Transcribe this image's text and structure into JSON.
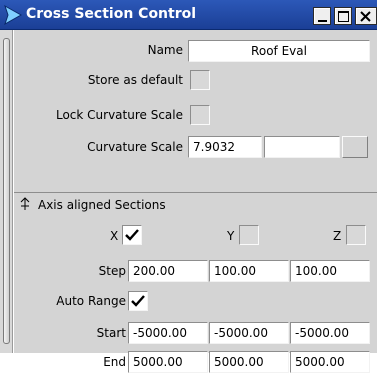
{
  "window": {
    "title": "Cross Section Control",
    "buttons": {
      "minimize_icon": "minimize-icon",
      "maximize_icon": "maximize-icon",
      "close_icon": "close-icon"
    }
  },
  "form": {
    "name_label": "Name",
    "name_value": "Roof Eval",
    "store_default_label": "Store as default",
    "store_default_checked": false,
    "lock_curvature_label": "Lock Curvature Scale",
    "lock_curvature_checked": false,
    "curvature_scale_label": "Curvature Scale",
    "curvature_scale_value": "7.9032"
  },
  "section": {
    "title": "Axis aligned Sections",
    "axes": [
      {
        "label": "X",
        "checked": true
      },
      {
        "label": "Y",
        "checked": false
      },
      {
        "label": "Z",
        "checked": false
      }
    ],
    "step_label": "Step",
    "step_values": [
      "200.00",
      "100.00",
      "100.00"
    ],
    "auto_range_label": "Auto Range",
    "auto_range_checked": true,
    "start_label": "Start",
    "start_values": [
      "-5000.00",
      "-5000.00",
      "-5000.00"
    ],
    "end_label": "End",
    "end_values": [
      "5000.00",
      "5000.00",
      "5000.00"
    ]
  }
}
